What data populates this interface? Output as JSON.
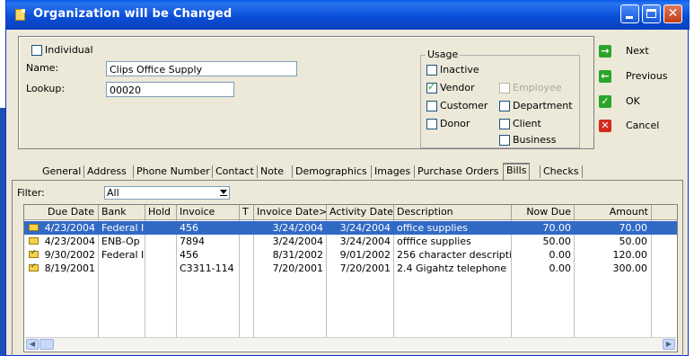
{
  "window": {
    "title": "Organization will be Changed"
  },
  "form": {
    "individual_label": "Individual",
    "name_label": "Name:",
    "name_value": "Clips Office Supply",
    "lookup_label": "Lookup:",
    "lookup_value": "00020",
    "usage": {
      "title": "Usage",
      "inactive": "Inactive",
      "vendor": "Vendor",
      "employee": "Employee",
      "customer": "Customer",
      "department": "Department",
      "donor": "Donor",
      "client": "Client",
      "business": "Business"
    }
  },
  "actions": {
    "next": "Next",
    "previous": "Previous",
    "ok": "OK",
    "cancel": "Cancel"
  },
  "tabs": [
    "General",
    "Address",
    "Phone Number",
    "Contact",
    "Note",
    "Demographics",
    "Images",
    "Purchase Orders",
    "Bills",
    "Checks"
  ],
  "filter": {
    "label": "Filter:",
    "value": "All"
  },
  "table": {
    "headers": [
      "Due Date",
      "Bank",
      "Hold",
      "Invoice",
      "T",
      "Invoice Date>",
      "Activity Date",
      "Description",
      "Now Due",
      "Amount"
    ],
    "rows": [
      {
        "due_date": "4/23/2004",
        "bank": "Federal I",
        "hold": "",
        "invoice": "456",
        "t": "",
        "invoice_date": "3/24/2004",
        "activity_date": "3/24/2004",
        "description": "office supplies",
        "now_due": "70.00",
        "amount": "70.00"
      },
      {
        "due_date": "4/23/2004",
        "bank": "ENB-Op",
        "hold": "",
        "invoice": "7894",
        "t": "",
        "invoice_date": "3/24/2004",
        "activity_date": "3/24/2004",
        "description": "offfice supplies",
        "now_due": "50.00",
        "amount": "50.00"
      },
      {
        "due_date": "9/30/2002",
        "bank": "Federal I",
        "hold": "",
        "invoice": "456",
        "t": "",
        "invoice_date": "8/31/2002",
        "activity_date": "9/01/2002",
        "description": "256 character descriptic",
        "now_due": "0.00",
        "amount": "120.00"
      },
      {
        "due_date": "8/19/2001",
        "bank": "",
        "hold": "",
        "invoice": "C3311-114",
        "t": "",
        "invoice_date": "7/20/2001",
        "activity_date": "7/20/2001",
        "description": "2.4 Gigahtz telephone",
        "now_due": "0.00",
        "amount": "300.00"
      }
    ]
  },
  "colors": {
    "title_bar": "#0a4fd8",
    "selection": "#316ac5",
    "dialog_bg": "#ece9d8"
  }
}
